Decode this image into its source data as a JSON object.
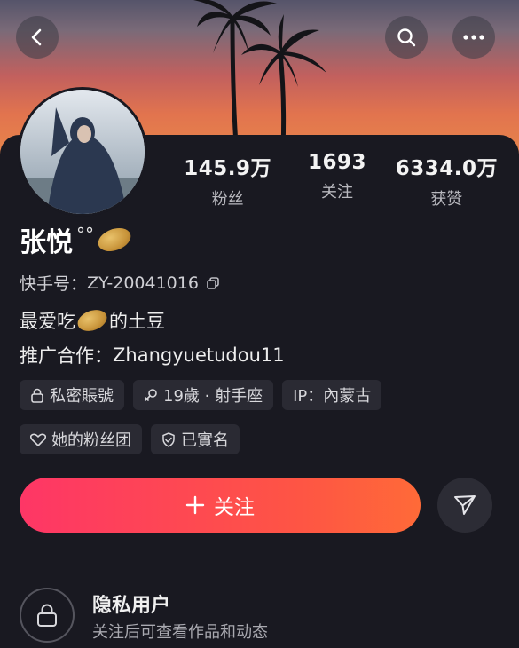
{
  "header": {
    "back_icon": "chevron-left-icon",
    "search_icon": "search-icon",
    "more_icon": "more-horizontal-icon"
  },
  "stats": [
    {
      "value": "145.9万",
      "label": "粉丝"
    },
    {
      "value": "1693",
      "label": "关注"
    },
    {
      "value": "6334.0万",
      "label": "获赞"
    }
  ],
  "profile": {
    "name": "张悦",
    "name_deco": "°°",
    "account_label": "快手号：",
    "account_id": "ZY-20041016",
    "bio_prefix": "最爱吃",
    "bio_suffix": "的土豆",
    "business_label": "推广合作：",
    "business_contact": "Zhangyuetudou11"
  },
  "tags": [
    {
      "icon": "lock-icon",
      "text": "私密賬號"
    },
    {
      "icon": "female-icon",
      "text": "19歲 · 射手座"
    },
    {
      "icon": "",
      "text": "IP：內蒙古"
    },
    {
      "icon": "heart-outline-icon",
      "text": "她的粉丝团"
    },
    {
      "icon": "shield-check-icon",
      "text": "已實名"
    }
  ],
  "actions": {
    "follow_label": "关注",
    "follow_icon": "plus-icon",
    "share_icon": "send-icon",
    "follow_gradient": [
      "#fe3666",
      "#ff6a38"
    ]
  },
  "private": {
    "icon": "lock-icon",
    "title": "隐私用户",
    "subtitle": "关注后可查看作品和动态"
  }
}
